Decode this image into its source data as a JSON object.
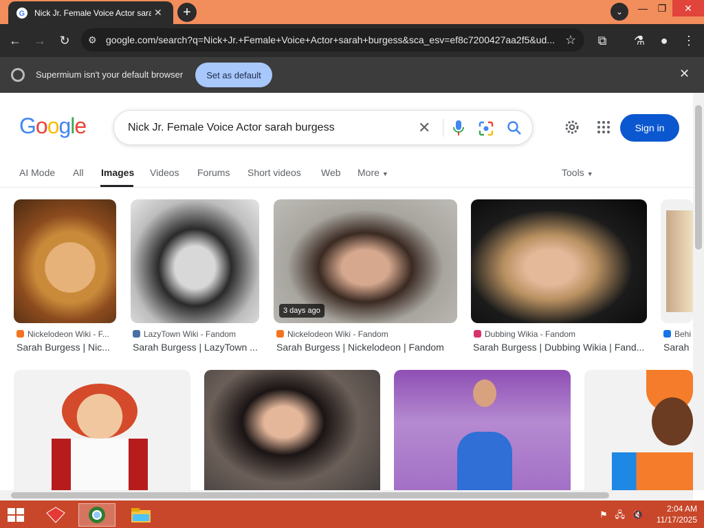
{
  "browser": {
    "tab_title": "Nick Jr. Female Voice Actor sarah",
    "url": "google.com/search?q=Nick+Jr.+Female+Voice+Actor+sarah+burgess&sca_esv=ef8c7200427aa2f5&ud...",
    "infobar_message": "Supermium isn't your default browser",
    "set_default_label": "Set as default",
    "new_tab_label": "+",
    "tab_close": "✕"
  },
  "google": {
    "logo_letters": [
      "G",
      "o",
      "o",
      "g",
      "l",
      "e"
    ],
    "logo_colors": [
      "#4285f4",
      "#ea4335",
      "#fbbc05",
      "#4285f4",
      "#34a853",
      "#ea4335"
    ],
    "query": "Nick Jr. Female Voice Actor sarah burgess",
    "sign_in_label": "Sign in",
    "tabs": [
      {
        "label": "AI Mode"
      },
      {
        "label": "All"
      },
      {
        "label": "Images"
      },
      {
        "label": "Videos"
      },
      {
        "label": "Forums"
      },
      {
        "label": "Short videos"
      },
      {
        "label": "Web"
      },
      {
        "label": "More"
      }
    ],
    "tools_label": "Tools"
  },
  "results_row1": [
    {
      "source": "Nickelodeon Wiki - F...",
      "caption": "Sarah Burgess | Nic...",
      "source_color": "#f47321",
      "badge": ""
    },
    {
      "source": "LazyTown Wiki - Fandom",
      "caption": "Sarah Burgess | LazyTown ...",
      "source_color": "#4a6fa5",
      "badge": ""
    },
    {
      "source": "Nickelodeon Wiki - Fandom",
      "caption": "Sarah Burgess | Nickelodeon | Fandom",
      "source_color": "#f47321",
      "badge": "3 days ago"
    },
    {
      "source": "Dubbing Wikia - Fandom",
      "caption": "Sarah Burgess | Dubbing Wikia | Fand...",
      "source_color": "#d6336c",
      "badge": ""
    },
    {
      "source": "Behi",
      "caption": "Sarah",
      "source_color": "#1a73e8",
      "badge": ""
    }
  ],
  "taskbar": {
    "time": "2:04 AM",
    "date": "11/17/2025"
  }
}
